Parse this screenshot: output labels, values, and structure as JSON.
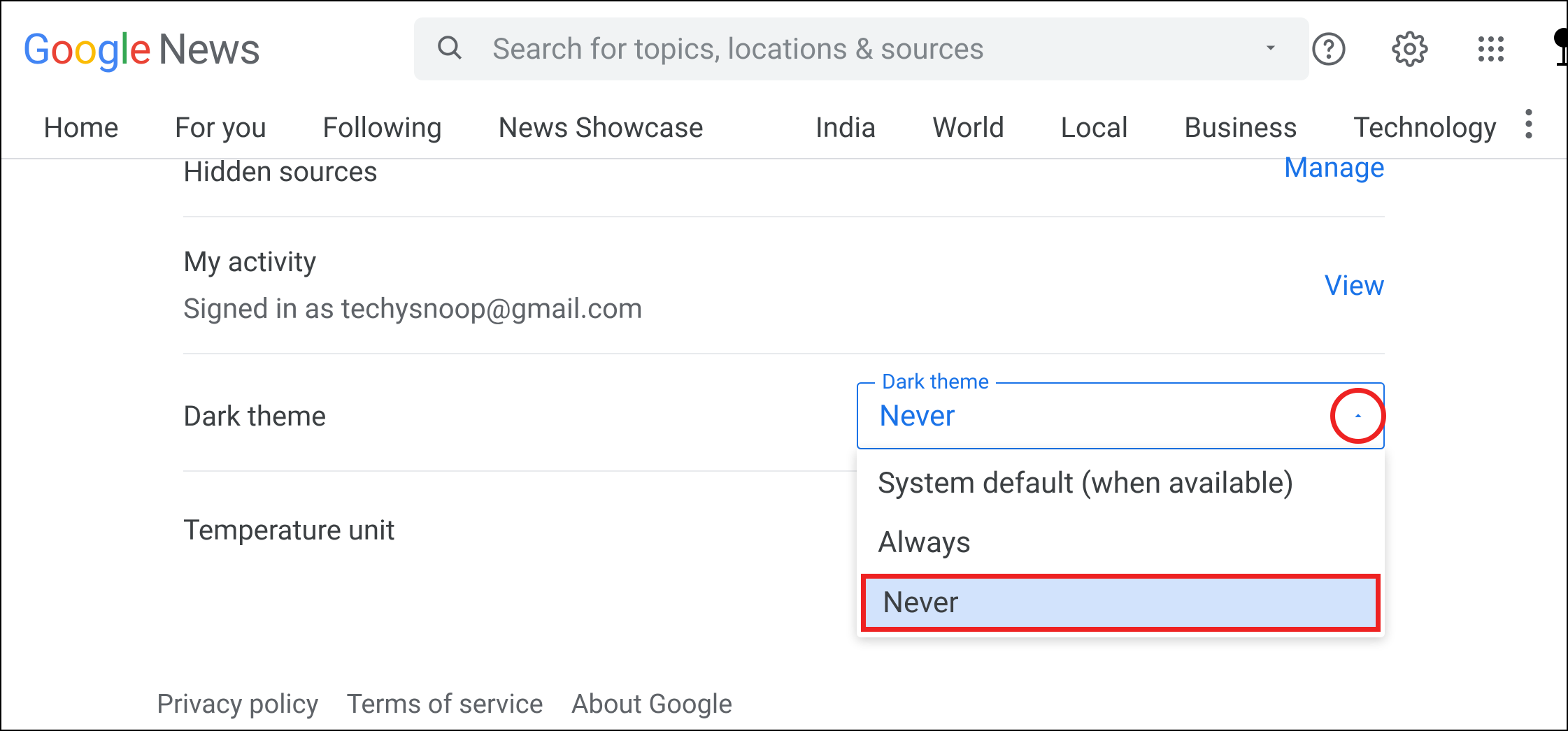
{
  "header": {
    "logo_news": "News",
    "search_placeholder": "Search for topics, locations & sources"
  },
  "nav": {
    "items": [
      "Home",
      "For you",
      "Following",
      "News Showcase"
    ],
    "topics": [
      "India",
      "World",
      "Local",
      "Business",
      "Technology"
    ]
  },
  "settings": {
    "hidden_sources": {
      "title": "Hidden sources",
      "action": "Manage"
    },
    "my_activity": {
      "title": "My activity",
      "subtitle": "Signed in as techysnoop@gmail.com",
      "action": "View"
    },
    "dark_theme": {
      "title": "Dark theme",
      "legend": "Dark theme",
      "selected": "Never",
      "options": [
        "System default (when available)",
        "Always",
        "Never"
      ]
    },
    "temperature": {
      "title": "Temperature unit"
    }
  },
  "footer": {
    "links": [
      "Privacy policy",
      "Terms of service",
      "About Google"
    ]
  }
}
